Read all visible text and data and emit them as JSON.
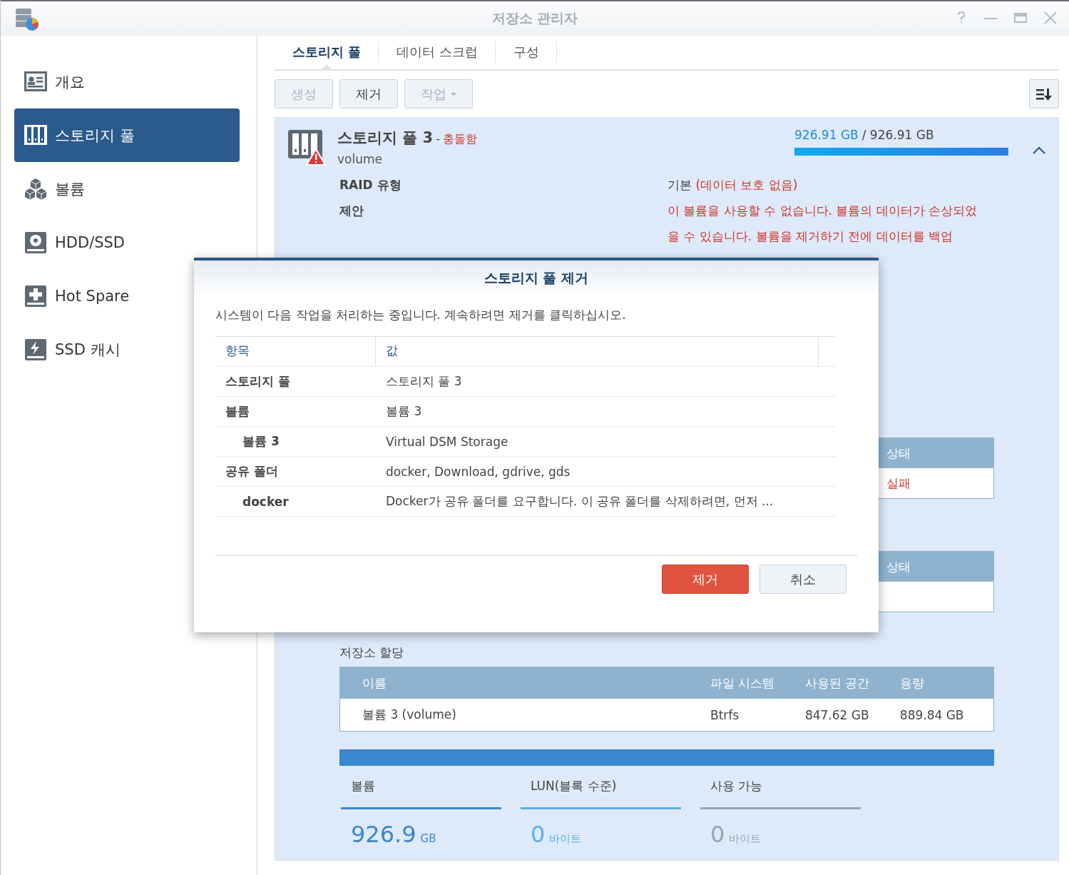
{
  "window": {
    "title": "저장소 관리자"
  },
  "sidebar": {
    "items": [
      {
        "label": "개요",
        "selected": false,
        "kind": "overview"
      },
      {
        "label": "스토리지 풀",
        "selected": true,
        "kind": "pool"
      },
      {
        "label": "볼륨",
        "selected": false,
        "kind": "volume"
      },
      {
        "label": "HDD/SSD",
        "selected": false,
        "kind": "disk"
      },
      {
        "label": "Hot Spare",
        "selected": false,
        "kind": "spare"
      },
      {
        "label": "SSD 캐시",
        "selected": false,
        "kind": "cache"
      }
    ]
  },
  "tabs": [
    {
      "label": "스토리지 풀",
      "selected": true
    },
    {
      "label": "데이터 스크럽",
      "selected": false
    },
    {
      "label": "구성",
      "selected": false
    }
  ],
  "toolbar": {
    "buttons": [
      {
        "label": "생성",
        "disabled": true,
        "kind": "button"
      },
      {
        "label": "제거",
        "disabled": false,
        "kind": "button"
      },
      {
        "label": "작업",
        "disabled": true,
        "kind": "dropdown"
      }
    ]
  },
  "pool": {
    "name": "스토리지 풀 3",
    "separator": "-",
    "status": "충돌함",
    "subtitle": "volume",
    "used": "926.91 GB",
    "total": "/ 926.91 GB",
    "level": 1,
    "expanded": true,
    "warning": true,
    "details": [
      {
        "label": "RAID 유형",
        "value": "기본",
        "note": "(데이터 보호 없음)"
      },
      {
        "label": "제안",
        "note": "이 볼륨을 사용할 수 없습니다. 볼륨의 데이터가 손상되었을 수 있습니다. 볼륨을 제거하기 전에 데이터를 백업"
      }
    ],
    "status_tables": [
      {
        "header": "상태",
        "value": "실패",
        "failed": true
      },
      {
        "header": "상태"
      }
    ],
    "allocation": {
      "title": "저장소 할당",
      "columns": [
        "이름",
        "파일 시스템",
        "사용된 공간",
        "용량"
      ],
      "rows": [
        [
          "볼륨 3 (volume)",
          "Btrfs",
          "847.62 GB",
          "889.84 GB"
        ]
      ],
      "level": 1
    },
    "stats": [
      {
        "label": "볼륨",
        "value": "926.9",
        "unit": "GB",
        "color": "#3a86d0"
      },
      {
        "label": "LUN(블록 수준)",
        "value": "0",
        "unit": "바이트",
        "color": "#5aaef0"
      },
      {
        "label": "사용 가능",
        "value": "0",
        "unit": "바이트",
        "color": "#9aa3ab"
      }
    ]
  },
  "dialog": {
    "title": "스토리지 풀 제거",
    "message": "시스템이 다음 작업을 처리하는 중입니다. 계속하려면 제거를 클릭하십시오.",
    "columns": [
      "항목",
      "값"
    ],
    "rows": [
      {
        "item": "스토리지 풀",
        "value": "스토리지 풀 3"
      },
      {
        "item": "볼륨",
        "value": "볼륨 3",
        "children": [
          {
            "item": "볼륨 3",
            "value": "Virtual DSM Storage"
          }
        ]
      },
      {
        "item": "공유 폴더",
        "value": "docker, Download, gdrive, gds",
        "children": [
          {
            "item": "docker",
            "value": "Docker가 공유 폴더를 요구합니다. 이 공유 폴더를 삭제하려면, 먼저 ..."
          }
        ]
      }
    ],
    "buttons": [
      {
        "label": "제거",
        "kind": "primary"
      },
      {
        "label": "취소",
        "kind": "default"
      }
    ]
  }
}
